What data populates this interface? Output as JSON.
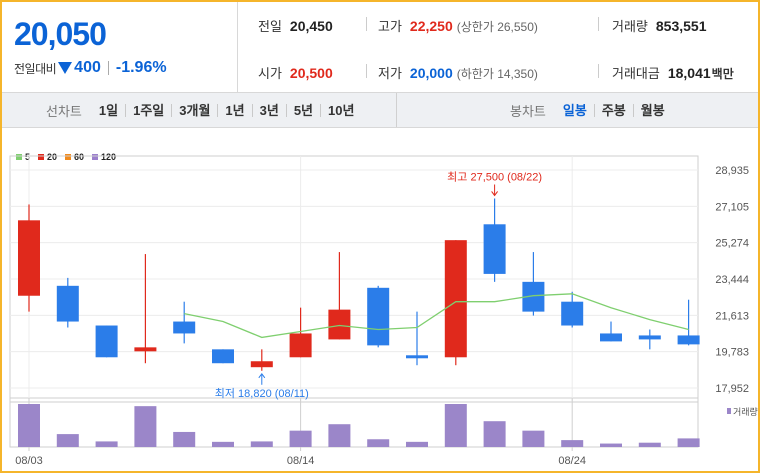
{
  "header": {
    "current_price": "20,050",
    "change_label": "전일대비",
    "change_value": "400",
    "change_rate": "-1.96%",
    "prev_close_label": "전일",
    "prev_close": "20,450",
    "high_label": "고가",
    "high": "22,250",
    "upper_limit": "(상한가 26,550)",
    "volume_label": "거래량",
    "volume": "853,551",
    "open_label": "시가",
    "open": "20,500",
    "low_label": "저가",
    "low": "20,000",
    "lower_limit": "(하한가 14,350)",
    "amount_label": "거래대금",
    "amount": "18,041",
    "amount_unit": "백만"
  },
  "colors": {
    "up": "#e0291c",
    "down": "#2b7de9",
    "ma5": "#7fcf6f",
    "ma20": "#e0291c",
    "ma60": "#f08a1c",
    "ma120": "#9b7fcc",
    "volume": "#9b86c9",
    "accent": "#0b63d6"
  },
  "periods": {
    "line_label": "선차트",
    "line_items": [
      "1일",
      "1주일",
      "3개월",
      "1년",
      "3년",
      "5년",
      "10년"
    ],
    "candle_label": "봉차트",
    "candle_items": [
      "일봉",
      "주봉",
      "월봉"
    ],
    "active_candle": "일봉"
  },
  "chart_data": {
    "type": "candlestick",
    "legend": [
      "5",
      "20",
      "60",
      "120"
    ],
    "y_ticks": [
      "28,935",
      "27,105",
      "25,274",
      "23,444",
      "21,613",
      "19,783",
      "17,952"
    ],
    "y_tick_values": [
      28935,
      27105,
      25274,
      23444,
      21613,
      19783,
      17952
    ],
    "ylim": [
      17952,
      28935
    ],
    "x_tick_labels": [
      "08/03",
      "08/14",
      "08/24"
    ],
    "candles": [
      {
        "date": "08/03",
        "open": 22600,
        "high": 27200,
        "low": 21800,
        "close": 26400
      },
      {
        "date": "08/04",
        "open": 23100,
        "high": 23500,
        "low": 21000,
        "close": 21300
      },
      {
        "date": "08/07",
        "open": 21100,
        "high": 21100,
        "low": 19500,
        "close": 19500
      },
      {
        "date": "08/08",
        "open": 19800,
        "high": 24700,
        "low": 19200,
        "close": 20000
      },
      {
        "date": "08/09",
        "open": 21300,
        "high": 22300,
        "low": 20200,
        "close": 20700
      },
      {
        "date": "08/10",
        "open": 19900,
        "high": 19900,
        "low": 19200,
        "close": 19200
      },
      {
        "date": "08/11",
        "open": 19000,
        "high": 19900,
        "low": 18820,
        "close": 19300
      },
      {
        "date": "08/14",
        "open": 19500,
        "high": 22000,
        "low": 19500,
        "close": 20700
      },
      {
        "date": "08/16",
        "open": 20400,
        "high": 24800,
        "low": 20400,
        "close": 21900
      },
      {
        "date": "08/17",
        "open": 23000,
        "high": 23100,
        "low": 20000,
        "close": 20100
      },
      {
        "date": "08/18",
        "open": 19600,
        "high": 21800,
        "low": 19100,
        "close": 19500
      },
      {
        "date": "08/21",
        "open": 19500,
        "high": 25400,
        "low": 19100,
        "close": 25400
      },
      {
        "date": "08/22",
        "open": 26200,
        "high": 27500,
        "low": 23300,
        "close": 23700
      },
      {
        "date": "08/23",
        "open": 23300,
        "high": 24800,
        "low": 21600,
        "close": 21800
      },
      {
        "date": "08/24",
        "open": 22300,
        "high": 22800,
        "low": 21000,
        "close": 21100
      },
      {
        "date": "08/25",
        "open": 20700,
        "high": 21300,
        "low": 20300,
        "close": 20300
      },
      {
        "date": "08/28",
        "open": 20600,
        "high": 20900,
        "low": 19900,
        "close": 20400
      },
      {
        "date": "08/29",
        "open": 20600,
        "high": 22400,
        "low": 20100,
        "close": 20150
      }
    ],
    "ma5": [
      null,
      null,
      null,
      null,
      21700,
      21300,
      20500,
      20800,
      21100,
      20900,
      21000,
      22300,
      22300,
      22600,
      22700,
      22000,
      21400,
      20900
    ],
    "volume_relative": [
      1.0,
      0.3,
      0.13,
      0.95,
      0.35,
      0.12,
      0.13,
      0.38,
      0.53,
      0.18,
      0.12,
      1.0,
      0.6,
      0.38,
      0.16,
      0.08,
      0.1,
      0.2
    ],
    "annotations": {
      "high": {
        "text": "최고 27,500 (08/22)",
        "index": 12,
        "price": 27500
      },
      "low": {
        "text": "최저 18,820 (08/11)",
        "index": 6,
        "price": 18820
      }
    },
    "volume_label": "거래량"
  }
}
